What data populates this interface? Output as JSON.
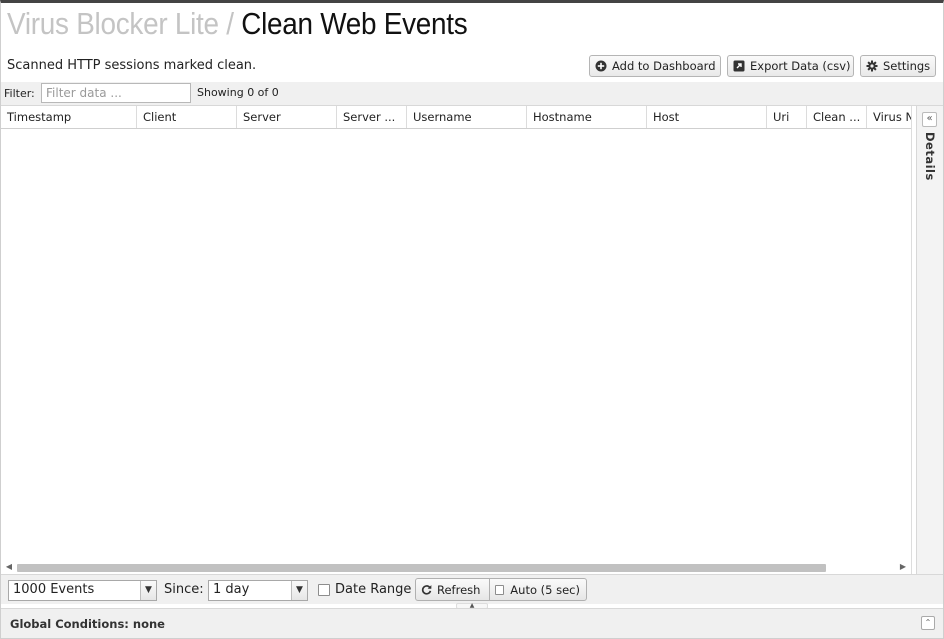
{
  "header": {
    "app_name": "Virus Blocker Lite",
    "separator": "/",
    "page_title": "Clean Web Events",
    "description": "Scanned HTTP sessions marked clean."
  },
  "toolbar": {
    "add_to_dashboard": "Add to Dashboard",
    "export_data": "Export Data (csv)",
    "settings": "Settings"
  },
  "filter": {
    "label": "Filter:",
    "placeholder": "Filter data ...",
    "value": "",
    "showing": "Showing 0 of 0"
  },
  "grid": {
    "columns": [
      "Timestamp",
      "Client",
      "Server",
      "Server ...",
      "Username",
      "Hostname",
      "Host",
      "Uri",
      "Clean ...",
      "Virus N"
    ],
    "rows": []
  },
  "details_panel": {
    "label": "Details"
  },
  "bottom_bar": {
    "events_select": "1000 Events",
    "since_label": "Since:",
    "since_select": "1 day",
    "date_range_label": "Date Range",
    "date_range_checked": false,
    "refresh": "Refresh",
    "auto_refresh": "Auto (5 sec)",
    "auto_refresh_checked": false
  },
  "global_conditions": {
    "label": "Global Conditions: none"
  }
}
